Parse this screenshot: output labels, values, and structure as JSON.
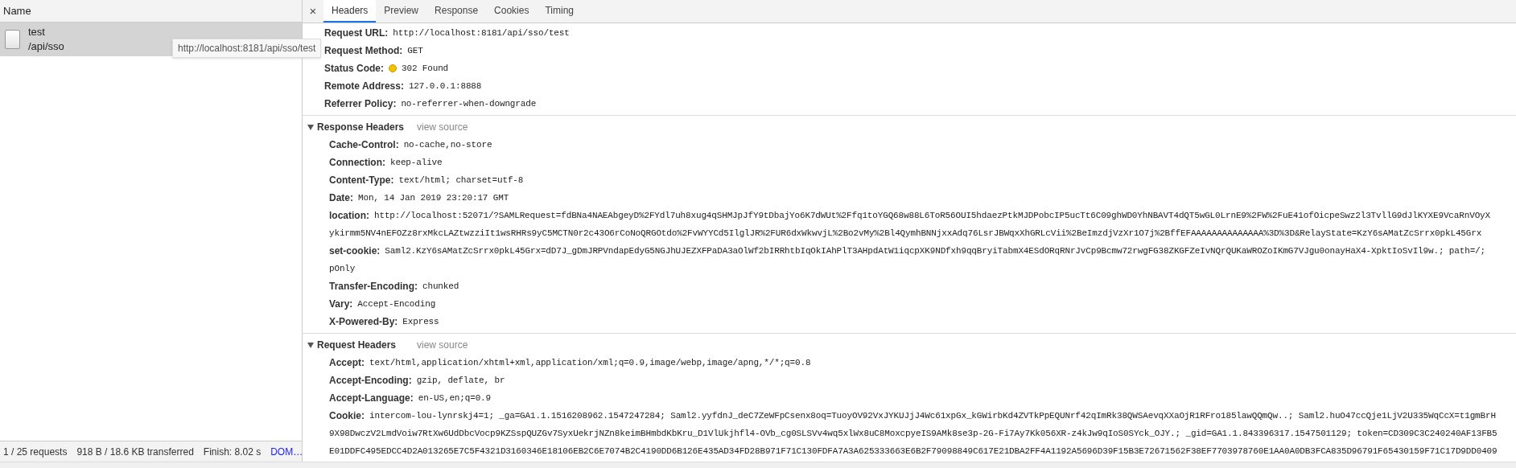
{
  "request_list": {
    "column": "Name",
    "requests": [
      {
        "name": "test",
        "path": "/api/sso",
        "selected": true
      }
    ],
    "tooltip": "http://localhost:8181/api/sso/test"
  },
  "status_bar": [
    {
      "text": "1 / 25 requests",
      "kind": "plain"
    },
    {
      "text": "918 B / 18.6 KB transferred",
      "kind": "plain"
    },
    {
      "text": "Finish: 8.02 s",
      "kind": "plain"
    },
    {
      "text": "DOM…",
      "kind": "link"
    }
  ],
  "details": {
    "close": "×",
    "tabs": [
      {
        "label": "Headers",
        "selected": true
      },
      {
        "label": "Preview",
        "selected": false
      },
      {
        "label": "Response",
        "selected": false
      },
      {
        "label": "Cookies",
        "selected": false
      },
      {
        "label": "Timing",
        "selected": false
      }
    ],
    "general": [
      {
        "name": "Request URL:",
        "lines": [
          "http://localhost:8181/api/sso/test"
        ],
        "kind": "plain"
      },
      {
        "name": "Request Method:",
        "lines": [
          "GET"
        ],
        "kind": "plain"
      },
      {
        "name": "Status Code:",
        "lines": [
          "302 Found"
        ],
        "kind": "status"
      },
      {
        "name": "Remote Address:",
        "lines": [
          "127.0.0.1:8888"
        ],
        "kind": "plain"
      },
      {
        "name": "Referrer Policy:",
        "lines": [
          "no-referrer-when-downgrade"
        ],
        "kind": "plain"
      }
    ],
    "sections": [
      {
        "title": "Response Headers",
        "expanded": true,
        "view_source": "view source",
        "headers": [
          {
            "name": "Cache-Control:",
            "lines": [
              "no-cache,no-store"
            ]
          },
          {
            "name": "Connection:",
            "lines": [
              "keep-alive"
            ]
          },
          {
            "name": "Content-Type:",
            "lines": [
              "text/html; charset=utf-8"
            ]
          },
          {
            "name": "Date:",
            "lines": [
              "Mon, 14 Jan 2019 23:20:17 GMT"
            ]
          },
          {
            "name": "location:",
            "lines": [
              "http://localhost:52071/?SAMLRequest=fdBNa4NAEAbgeyD%2FYdl7uh8xug4qSHMJpJfY9tDbajYo6K7dWUt%2Ffq1toYGQ68w88L6ToR56OUI5hdaezPtkMJDPobcIP5ucTt6C09ghWD0YhNBAVT4dQT5wGL0LrnE9%2FW%2FuE41ofOicpeSwz2l3TvllG9dJlKYXE9VcaRnVOyX",
              "ykirmm5NV4nEFOZz8rxMkcLAZtwzziIt1wsRHRs9yC5MCTN0r2c43O6rCoNoQRGOtdo%2FvWYYCd5IlglJR%2FUR6dxWkwvjL%2Bo2vMy%2Bl4QymhBNNjxxAdq76LsrJBWqxXhGRLcVii%2BeImzdjVzXr1O7j%2BffEFAAAAAAAAAAAAAA%3D%3D&RelayState=KzY6sAMatZcSrrx0pkL45Grx"
            ]
          },
          {
            "name": "set-cookie:",
            "lines": [
              "Saml2.KzY6sAMatZcSrrx0pkL45Grx=dD7J_gDmJRPVndapEdyG5NGJhUJEZXFPaDA3aOlWf2bIRRhtbIqOkIAhPlT3AHpdAtW1iqcpXK9NDfxh9qqBryiTabmX4ESdORqRNrJvCp9Bcmw72rwgFG38ZKGFZeIvNQrQUKaWROZoIKmG7VJgu0onayHaX4-XpktIoSvIl9w.; path=/;",
              "pOnly"
            ]
          },
          {
            "name": "Transfer-Encoding:",
            "lines": [
              "chunked"
            ]
          },
          {
            "name": "Vary:",
            "lines": [
              "Accept-Encoding"
            ]
          },
          {
            "name": "X-Powered-By:",
            "lines": [
              "Express"
            ]
          }
        ]
      },
      {
        "title": "Request Headers",
        "expanded": true,
        "view_source": "view source",
        "headers": [
          {
            "name": "Accept:",
            "lines": [
              "text/html,application/xhtml+xml,application/xml;q=0.9,image/webp,image/apng,*/*;q=0.8"
            ]
          },
          {
            "name": "Accept-Encoding:",
            "lines": [
              "gzip, deflate, br"
            ]
          },
          {
            "name": "Accept-Language:",
            "lines": [
              "en-US,en;q=0.9"
            ]
          },
          {
            "name": "Cookie:",
            "lines": [
              "intercom-lou-lynrskj4=1; _ga=GA1.1.1516208962.1547247284; Saml2.yyfdnJ_deC7ZeWFpCsenx8oq=TuoyOV92VxJYKUJjJ4Wc61xpGx_kGWirbKd4ZVTkPpEQUNrf42qImRk38QWSAevqXXaOjR1RFro185lawQQmQw..; Saml2.huO47ccQje1LjV2U335WqCcX=t1gmBrH",
              "9X98DwczV2LmdVoiw7RtXw6UdDbcVocp9KZSspQUZGv7SyxUekrjNZn8keimBHmbdKbKru_D1VlUkjhfl4-OVb_cg0SLSVv4wq5xlWx8uC8MoxcpyeIS9AMk8se3p-2G-Fi7Ay7Kk056XR-z4kJw9qIoS0SYck_OJY.; _gid=GA1.1.843396317.1547501129; token=CD309C3C240240AF13FB5",
              "E01DDFC495EDCC4D2A013265E7C5F4321D3160346E18106EB2C6E7074B2C4190DD6B126E435AD34FD28B971F71C130FDFA7A3A625333663E6B2F79098849C617E21DBA2FF4A1192A5696D39F15B3E72671562F38EF7703978760E1AA0A0DB3FCA835D96791F65430159F71C17D9DD0409"
            ]
          }
        ]
      }
    ]
  }
}
